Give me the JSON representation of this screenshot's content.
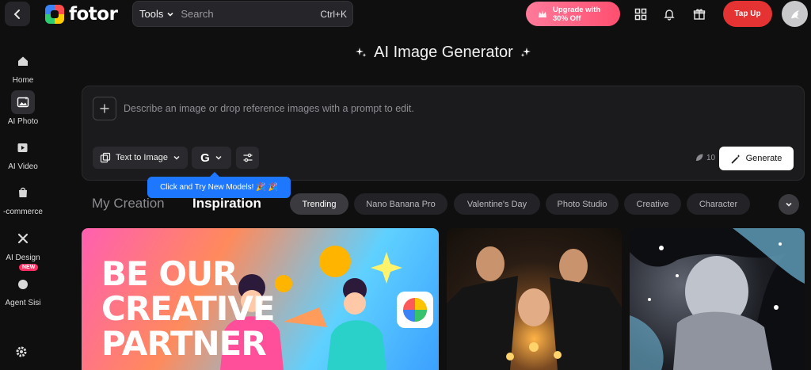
{
  "header": {
    "logo_text": "fotor",
    "tools_label": "Tools",
    "search_placeholder": "Search",
    "search_shortcut": "Ctrl+K",
    "upgrade_line1": "Upgrade with",
    "upgrade_line2": "30% Off",
    "topup_label": "Tap Up"
  },
  "sidebar": {
    "items": [
      {
        "label": "Home",
        "icon": "home-icon"
      },
      {
        "label": "AI Photo",
        "icon": "ai-photo-icon",
        "active": true
      },
      {
        "label": "AI Video",
        "icon": "ai-video-icon"
      },
      {
        "label": "-commerce",
        "icon": "shopping-bag-icon"
      },
      {
        "label": "AI Design",
        "icon": "design-icon"
      },
      {
        "label": "Agent Sisi",
        "icon": "agent-icon",
        "badge": "NEW"
      }
    ]
  },
  "main": {
    "title": "AI Image Generator",
    "prompt_placeholder": "Describe an image or drop reference images with a prompt to edit.",
    "mode_label": "Text to Image",
    "model_letter": "G",
    "credits": "10",
    "generate_label": "Generate",
    "tooltip": "Click and Try New Models! 🎉 🎉",
    "tabs": [
      "My Creation",
      "Inspiration"
    ],
    "chips": [
      "Trending",
      "Nano Banana Pro",
      "Valentine's Day",
      "Photo Studio",
      "Creative",
      "Character"
    ]
  },
  "gallery": {
    "headline": "BE OUR CREATIVE PARTNER"
  },
  "colors": {
    "accent_red": "#e53232",
    "upgrade_pink": "#ff4f70",
    "tooltip_blue": "#1e78ff",
    "background": "#0f0f10"
  }
}
